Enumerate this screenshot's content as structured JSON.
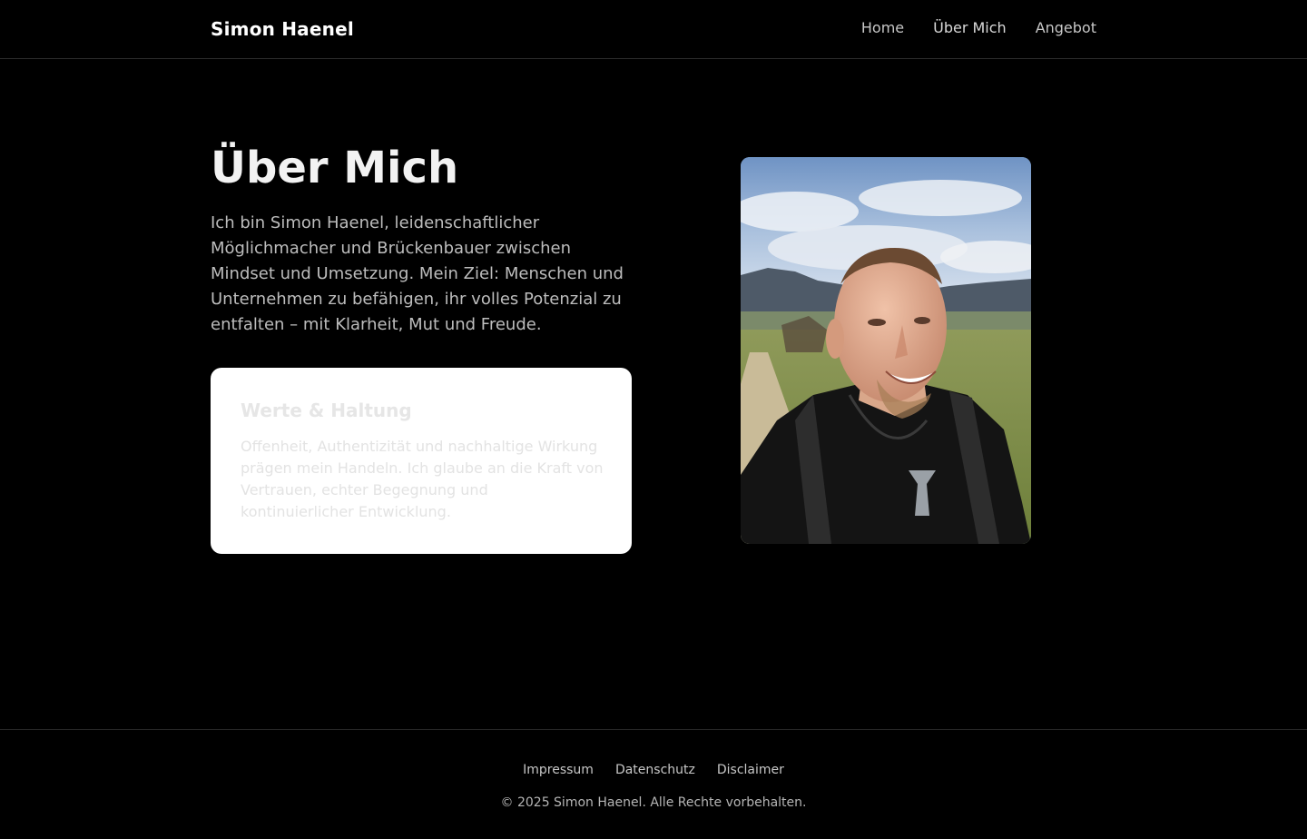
{
  "header": {
    "brand": "Simon Haenel",
    "nav": [
      {
        "label": "Home"
      },
      {
        "label": "Über Mich"
      },
      {
        "label": "Angebot"
      }
    ]
  },
  "main": {
    "title": "Über Mich",
    "intro": "Ich bin Simon Haenel, leidenschaftlicher Möglichmacher und Brückenbauer zwischen Mindset und Umsetzung. Mein Ziel: Menschen und Unternehmen zu befähigen, ihr volles Potenzial zu entfalten – mit Klarheit, Mut und Freude.",
    "values_card": {
      "heading": "Werte & Haltung",
      "text": "Offenheit, Authentizität und nachhaltige Wirkung prägen mein Handeln. Ich glaube an die Kraft von Vertrauen, echter Begegnung und kontinuierlicher Entwicklung."
    },
    "portrait_alt": "Simon Haenel"
  },
  "footer": {
    "links": [
      {
        "label": "Impressum"
      },
      {
        "label": "Datenschutz"
      },
      {
        "label": "Disclaimer"
      }
    ],
    "copyright": "© 2025 Simon Haenel. Alle Rechte vorbehalten."
  },
  "colors": {
    "background": "#000000",
    "card_background": "#ffffff",
    "text_muted": "#bdbdbd"
  }
}
